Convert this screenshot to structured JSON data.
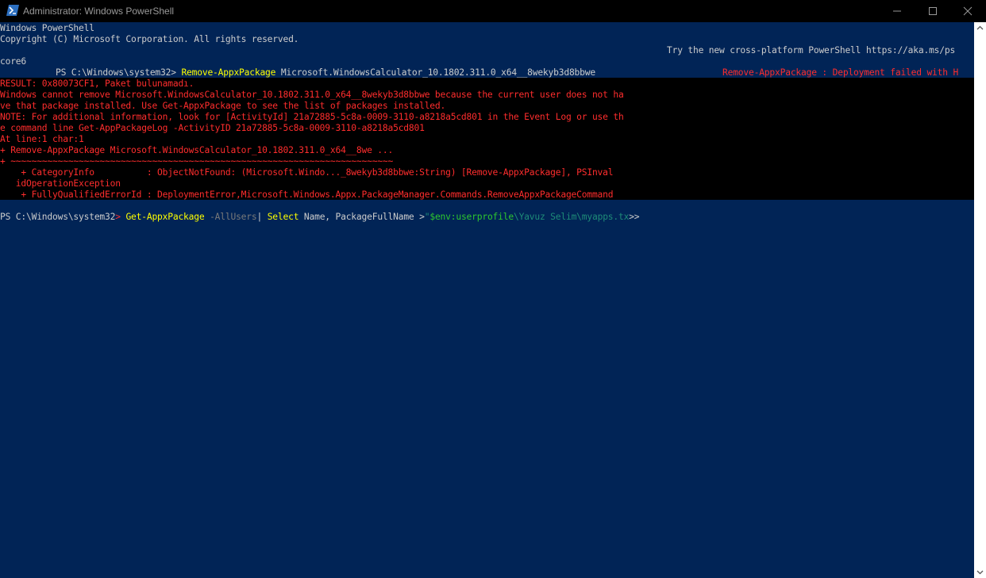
{
  "window": {
    "title": "Administrator: Windows PowerShell",
    "buttons": {
      "minimize": "minimize",
      "maximize": "maximize",
      "close": "close"
    }
  },
  "colors": {
    "background": "#012456",
    "error": "#ff2d2d",
    "command": "#ffff00",
    "parameter": "#7a7a7a",
    "string": "#3aa0b0"
  },
  "console": {
    "header1": "Windows PowerShell",
    "header2": "Copyright (C) Microsoft Corporation. All rights reserved.",
    "header3": "Try the new cross-platform PowerShell https://aka.ms/ps",
    "header4": "core6",
    "prompt1": "PS C:\\Windows\\system32> ",
    "cmd1_name": "Remove-AppxPackage",
    "cmd1_arg": " Microsoft.WindowsCalculator_10.1802.311.0_x64__8wekyb3d8bbwe",
    "err_head": "Remove-AppxPackage : Deployment failed with H",
    "err_lines": [
      "RESULT: 0x80073CF1, Paket bulunamadı.",
      "Windows cannot remove Microsoft.WindowsCalculator_10.1802.311.0_x64__8wekyb3d8bbwe because the current user does not ha",
      "ve that package installed. Use Get-AppxPackage to see the list of packages installed.",
      "NOTE: For additional information, look for [ActivityId] 21a72885-5c8a-0009-3110-a8218a5cd801 in the Event Log or use th",
      "e command line Get-AppPackageLog -ActivityID 21a72885-5c8a-0009-3110-a8218a5cd801",
      "At line:1 char:1",
      "+ Remove-AppxPackage Microsoft.WindowsCalculator_10.1802.311.0_x64__8we ...",
      "+ ~~~~~~~~~~~~~~~~~~~~~~~~~~~~~~~~~~~~~~~~~~~~~~~~~~~~~~~~~~~~~~~~~~~~~~~~~",
      "    + CategoryInfo          : ObjectNotFound: (Microsoft.Windo..._8wekyb3d8bbwe:String) [Remove-AppxPackage], PSInval",
      "   idOperationException",
      "    + FullyQualifiedErrorId : DeploymentError,Microsoft.Windows.Appx.PackageManager.Commands.RemoveAppxPackageCommand"
    ],
    "prompt2": "PS C:\\Windows\\system32",
    "prompt2_gt": "> ",
    "cmd2_name": "Get-AppxPackage",
    "cmd2_param": " -AllUsers",
    "cmd2_pipe": "| ",
    "cmd2_select": "Select",
    "cmd2_fields": " Name, PackageFullName >",
    "cmd2_quote": "\"",
    "cmd2_var": "$env:userprofile",
    "cmd2_path": "\\Yavuz Selim\\myapps.tx",
    "cmd2_end": ">>"
  }
}
